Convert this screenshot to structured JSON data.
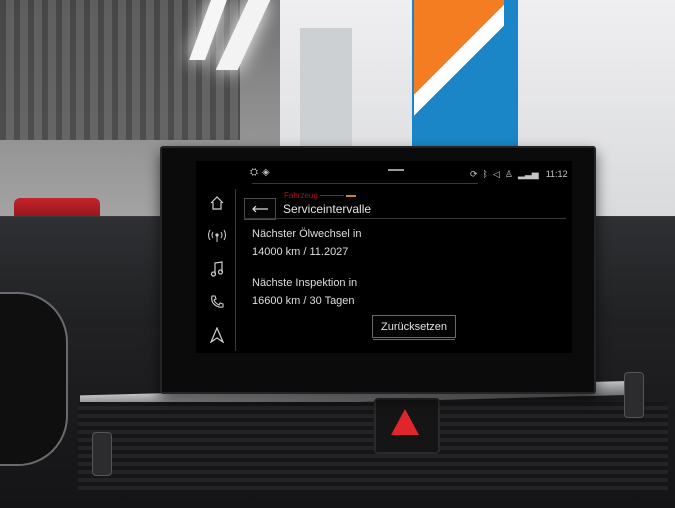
{
  "status": {
    "time": "11:12"
  },
  "breadcrumb": {
    "parent": "Fahrzeug"
  },
  "page": {
    "title": "Serviceintervalle"
  },
  "oil_change": {
    "label": "Nächster Ölwechsel in",
    "value": "14000 km / 11.2027"
  },
  "inspection": {
    "label": "Nächste Inspektion in",
    "value": "16600 km / 30 Tagen"
  },
  "actions": {
    "reset_label": "Zurücksetzen"
  },
  "sidebar": {
    "items": [
      {
        "icon": "home-icon"
      },
      {
        "icon": "radio-icon"
      },
      {
        "icon": "music-icon"
      },
      {
        "icon": "phone-icon"
      },
      {
        "icon": "navigation-icon"
      }
    ]
  },
  "colors": {
    "accent_red": "#a3161c",
    "screen_bg": "#000000",
    "text": "#e4e4e4"
  }
}
